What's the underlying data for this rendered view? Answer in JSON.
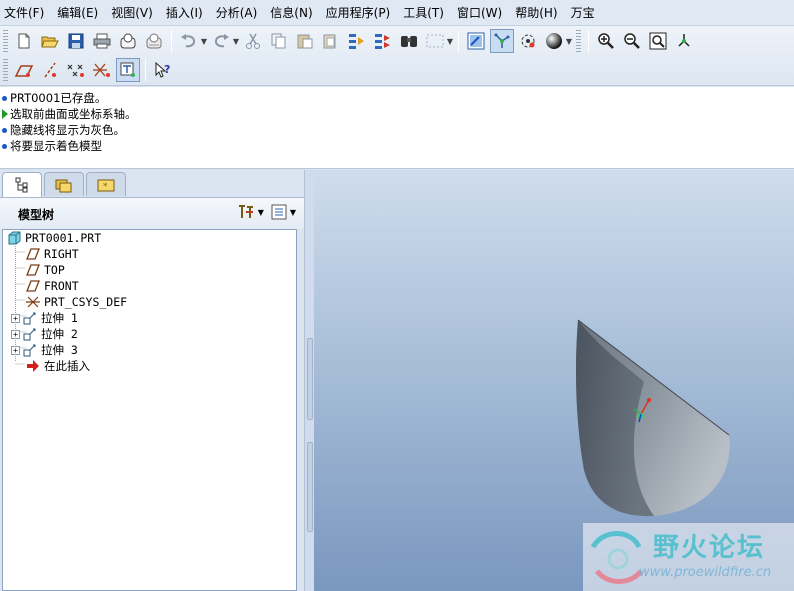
{
  "menubar": {
    "items": [
      "文件(F)",
      "编辑(E)",
      "视图(V)",
      "插入(I)",
      "分析(A)",
      "信息(N)",
      "应用程序(P)",
      "工具(T)",
      "窗口(W)",
      "帮助(H)",
      "万宝"
    ]
  },
  "toolbar": {
    "row1_icons": [
      "new-icon",
      "open-icon",
      "save-icon",
      "print-icon",
      "send-mail-icon",
      "mail-attach-icon",
      "undo-icon",
      "redo-icon",
      "cut-icon",
      "copy-icon",
      "paste-icon",
      "paste-special-icon",
      "regenerate-icon",
      "regen-manager-icon",
      "find-icon",
      "select-box-icon",
      "repaint-icon",
      "spin-center-icon",
      "orient-mode-icon",
      "shading-icon",
      "zoom-in-icon",
      "zoom-out-icon",
      "refit-icon",
      "reorient-icon"
    ],
    "row2_icons": [
      "datum-planes-icon",
      "datum-axes-icon",
      "datum-points-icon",
      "coord-systems-icon",
      "annotation-display-icon",
      "whats-this-icon"
    ]
  },
  "messages": [
    {
      "kind": "info",
      "text": "PRT0001已存盘。"
    },
    {
      "kind": "prompt",
      "text": "选取前曲面或坐标系轴。"
    },
    {
      "kind": "info",
      "text": "隐藏线将显示为灰色。"
    },
    {
      "kind": "info",
      "text": "将要显示着色模型"
    }
  ],
  "navigator": {
    "title": "模型树",
    "tree": [
      {
        "label": "PRT0001.PRT",
        "icon": "part-icon",
        "expandable": false
      },
      {
        "label": "RIGHT",
        "icon": "datum-plane-icon",
        "expandable": false
      },
      {
        "label": "TOP",
        "icon": "datum-plane-icon",
        "expandable": false
      },
      {
        "label": "FRONT",
        "icon": "datum-plane-icon",
        "expandable": false
      },
      {
        "label": "PRT_CSYS_DEF",
        "icon": "csys-icon",
        "expandable": false
      },
      {
        "label": "拉伸 1",
        "icon": "extrude-icon",
        "expandable": true
      },
      {
        "label": "拉伸 2",
        "icon": "extrude-icon",
        "expandable": true
      },
      {
        "label": "拉伸 3",
        "icon": "extrude-icon",
        "expandable": true
      },
      {
        "label": "在此插入",
        "icon": "insert-here-icon",
        "expandable": false
      }
    ]
  },
  "watermark": {
    "title": "野火论坛",
    "url": "www.proewildfire.cn"
  },
  "colors": {
    "bullet": "#1a56c4",
    "prompt_arrow": "#1b9a2a",
    "insert_arrow": "#d0201a",
    "graphics_top": "#cfdced",
    "graphics_bottom": "#7a97bf",
    "model_shade": "#5d6773"
  }
}
